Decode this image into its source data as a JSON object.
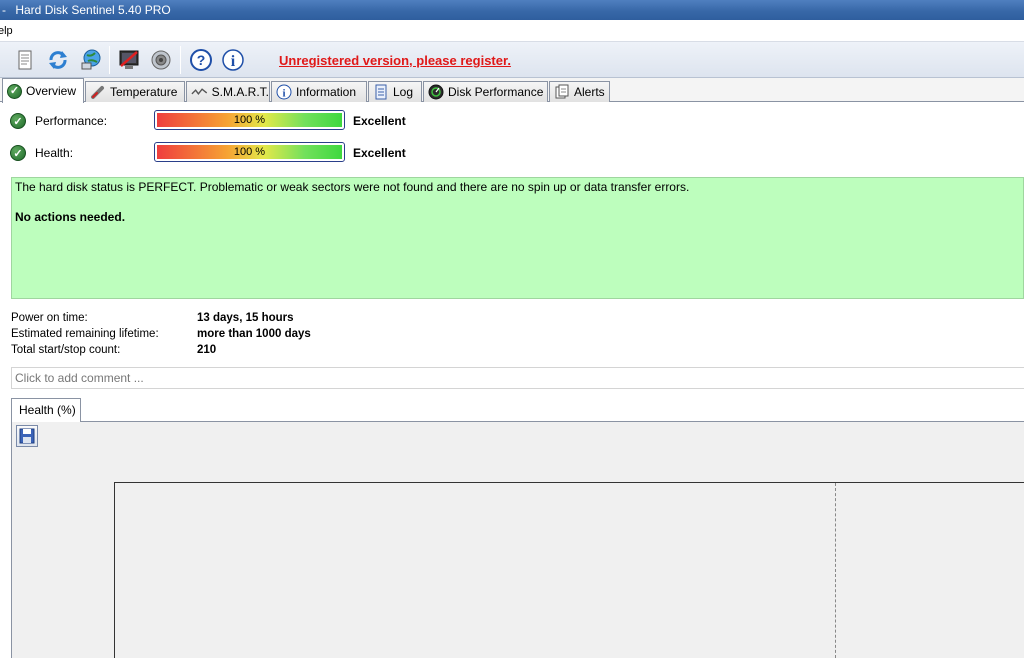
{
  "window": {
    "title": "Hard Disk Sentinel 5.40 PRO",
    "title_prefix": "-"
  },
  "menu": {
    "items": [
      {
        "label": "elp"
      }
    ]
  },
  "toolbar": {
    "buttons": [
      {
        "icon": "report-icon"
      },
      {
        "icon": "refresh-icon"
      },
      {
        "icon": "network-globe-icon"
      },
      {
        "icon": "alert-monitor-icon"
      },
      {
        "icon": "sound-icon"
      },
      {
        "icon": "help-icon"
      },
      {
        "icon": "info-icon"
      }
    ],
    "register_text": "Unregistered version, please register.",
    "register_color": "#e01818"
  },
  "tabs": [
    {
      "label": "Overview",
      "icon": "check-icon",
      "active": true
    },
    {
      "label": "Temperature",
      "icon": "thermometer-icon"
    },
    {
      "label": "S.M.A.R.T.",
      "icon": "smart-icon"
    },
    {
      "label": "Information",
      "icon": "info-icon"
    },
    {
      "label": "Log",
      "icon": "log-icon"
    },
    {
      "label": "Disk Performance",
      "icon": "performance-icon"
    },
    {
      "label": "Alerts",
      "icon": "alerts-icon"
    }
  ],
  "overview": {
    "performance": {
      "label": "Performance:",
      "percent_text": "100 %",
      "percent": 100,
      "rating": "Excellent"
    },
    "health": {
      "label": "Health:",
      "percent_text": "100 %",
      "percent": 100,
      "rating": "Excellent"
    },
    "status_message": "The hard disk status is PERFECT. Problematic or weak sectors were not found and there are no spin up or data transfer errors.",
    "actions_message": "No actions needed.",
    "status_box_color": "#bdfebd",
    "details": [
      {
        "label": "Power on time:",
        "value": "13 days, 15 hours"
      },
      {
        "label": "Estimated remaining lifetime:",
        "value": "more than 1000 days"
      },
      {
        "label": "Total start/stop count:",
        "value": "210"
      }
    ],
    "comment_placeholder": "Click to add comment ..."
  },
  "chart_panel": {
    "tab_label": "Health (%)",
    "save_icon": "save-icon"
  }
}
